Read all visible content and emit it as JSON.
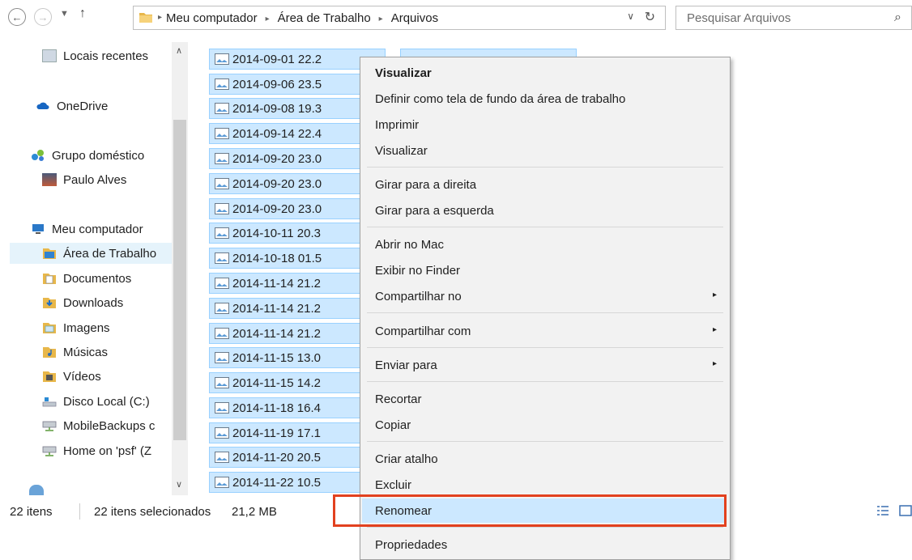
{
  "address": {
    "crumbs": [
      "Meu computador",
      "Área de Trabalho",
      "Arquivos"
    ],
    "search_placeholder": "Pesquisar Arquivos"
  },
  "nav": {
    "items": [
      {
        "label": "Locais recentes",
        "icon": "recent-icon"
      },
      {
        "label": "OneDrive",
        "icon": "cloud-icon"
      },
      {
        "label": "Grupo doméstico",
        "icon": "homegroup-icon"
      },
      {
        "label": "Paulo Alves",
        "icon": "user-avatar-icon"
      },
      {
        "label": "Meu computador",
        "icon": "computer-icon"
      },
      {
        "label": "Área de Trabalho",
        "icon": "desktop-folder-icon"
      },
      {
        "label": "Documentos",
        "icon": "documents-folder-icon"
      },
      {
        "label": "Downloads",
        "icon": "downloads-folder-icon"
      },
      {
        "label": "Imagens",
        "icon": "pictures-folder-icon"
      },
      {
        "label": "Músicas",
        "icon": "music-folder-icon"
      },
      {
        "label": "Vídeos",
        "icon": "videos-folder-icon"
      },
      {
        "label": "Disco Local (C:)",
        "icon": "drive-icon"
      },
      {
        "label": "MobileBackups c",
        "icon": "network-drive-icon"
      },
      {
        "label": "Home on 'psf' (Z",
        "icon": "network-drive-icon"
      }
    ]
  },
  "files": [
    "2014-09-01 22.2",
    "2014-09-06 23.5",
    "2014-09-08 19.3",
    "2014-09-14 22.4",
    "2014-09-20 23.0",
    "2014-09-20 23.0",
    "2014-09-20 23.0",
    "2014-10-11 20.3",
    "2014-10-18 01.5",
    "2014-11-14 21.2",
    "2014-11-14 21.2",
    "2014-11-14 21.2",
    "2014-11-15 13.0",
    "2014-11-15 14.2",
    "2014-11-18 16.4",
    "2014-11-19 17.1",
    "2014-11-20 20.5",
    "2014-11-22 10.5"
  ],
  "menu": {
    "items": [
      {
        "label": "Visualizar"
      },
      {
        "label": "Definir como tela de fundo da área de trabalho"
      },
      {
        "label": "Imprimir"
      },
      {
        "label": "Visualizar"
      },
      {
        "label": "Girar para a direita"
      },
      {
        "label": "Girar para a esquerda"
      },
      {
        "label": "Abrir no Mac"
      },
      {
        "label": "Exibir no Finder"
      },
      {
        "label": "Compartilhar no"
      },
      {
        "label": "Compartilhar com"
      },
      {
        "label": "Enviar para"
      },
      {
        "label": "Recortar"
      },
      {
        "label": "Copiar"
      },
      {
        "label": "Criar atalho"
      },
      {
        "label": "Excluir"
      },
      {
        "label": "Renomear"
      },
      {
        "label": "Propriedades"
      }
    ]
  },
  "status": {
    "count": "22 itens",
    "selected": "22 itens selecionados",
    "size": "21,2 MB"
  }
}
